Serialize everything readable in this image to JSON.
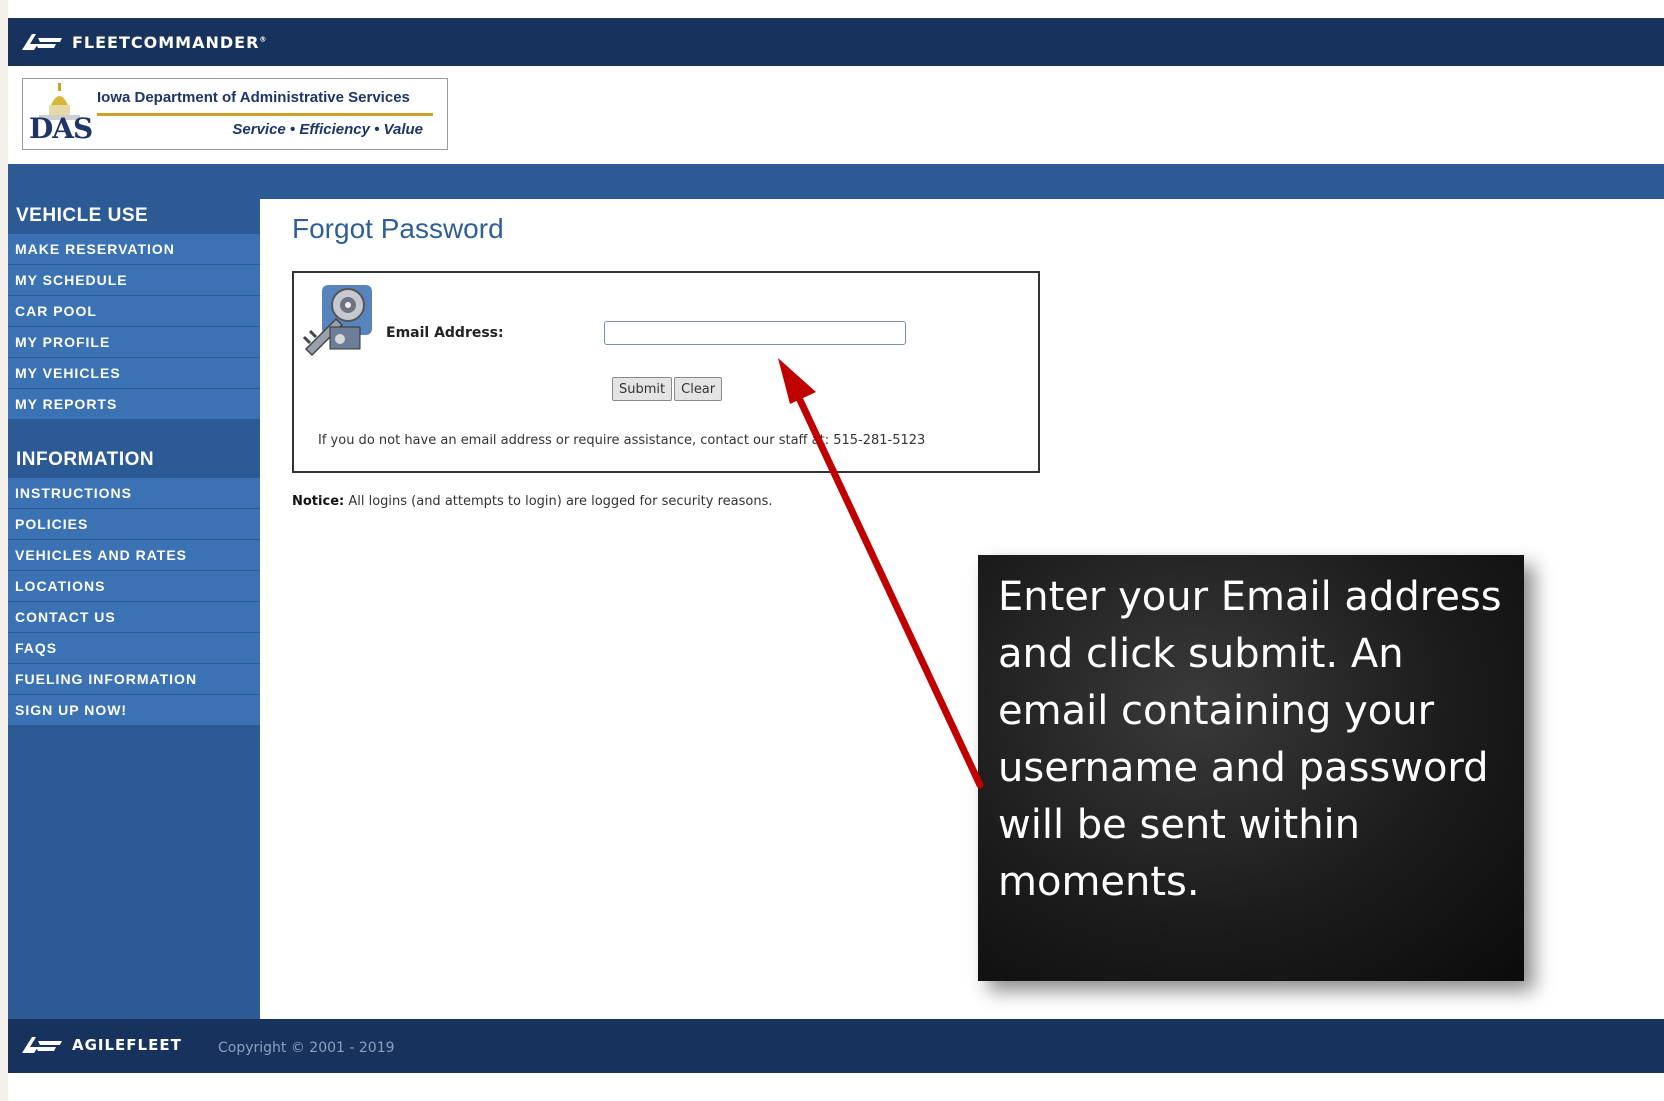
{
  "header": {
    "brand": "FLEETCOMMANDER",
    "brand_mark": "®"
  },
  "agency": {
    "title": "Iowa Department of Administrative Services",
    "tagline": "Service • Efficiency • Value",
    "logo_letters": "DAS"
  },
  "sidebar": {
    "sections": [
      {
        "title": "VEHICLE USE",
        "items": [
          "MAKE RESERVATION",
          "MY SCHEDULE",
          "CAR POOL",
          "MY PROFILE",
          "MY VEHICLES",
          "MY REPORTS"
        ]
      },
      {
        "title": "INFORMATION",
        "items": [
          "INSTRUCTIONS",
          "POLICIES",
          "VEHICLES AND RATES",
          "LOCATIONS",
          "CONTACT US",
          "FAQS",
          "FUELING INFORMATION",
          "SIGN UP NOW!"
        ]
      }
    ]
  },
  "main": {
    "title": "Forgot Password",
    "form": {
      "email_label": "Email Address:",
      "email_value": "",
      "submit_label": "Submit",
      "clear_label": "Clear",
      "help_text": "If you do not have an email address or require assistance, contact our staff at: 515-281-5123"
    },
    "notice_label": "Notice:",
    "notice_text": " All logins (and attempts to login) are logged for security reasons."
  },
  "footer": {
    "brand": "AGILEFLEET",
    "copyright": "Copyright © 2001 - 2019"
  },
  "callout": {
    "text": "Enter your Email address and click submit. An email containing your username and password will be sent within moments."
  },
  "colors": {
    "header_bg": "#17335d",
    "sidebar_bg": "#2b5a95",
    "nav_item_bg": "#3b72b4",
    "title_color": "#2f5f97",
    "arrow_color": "#c00000"
  }
}
